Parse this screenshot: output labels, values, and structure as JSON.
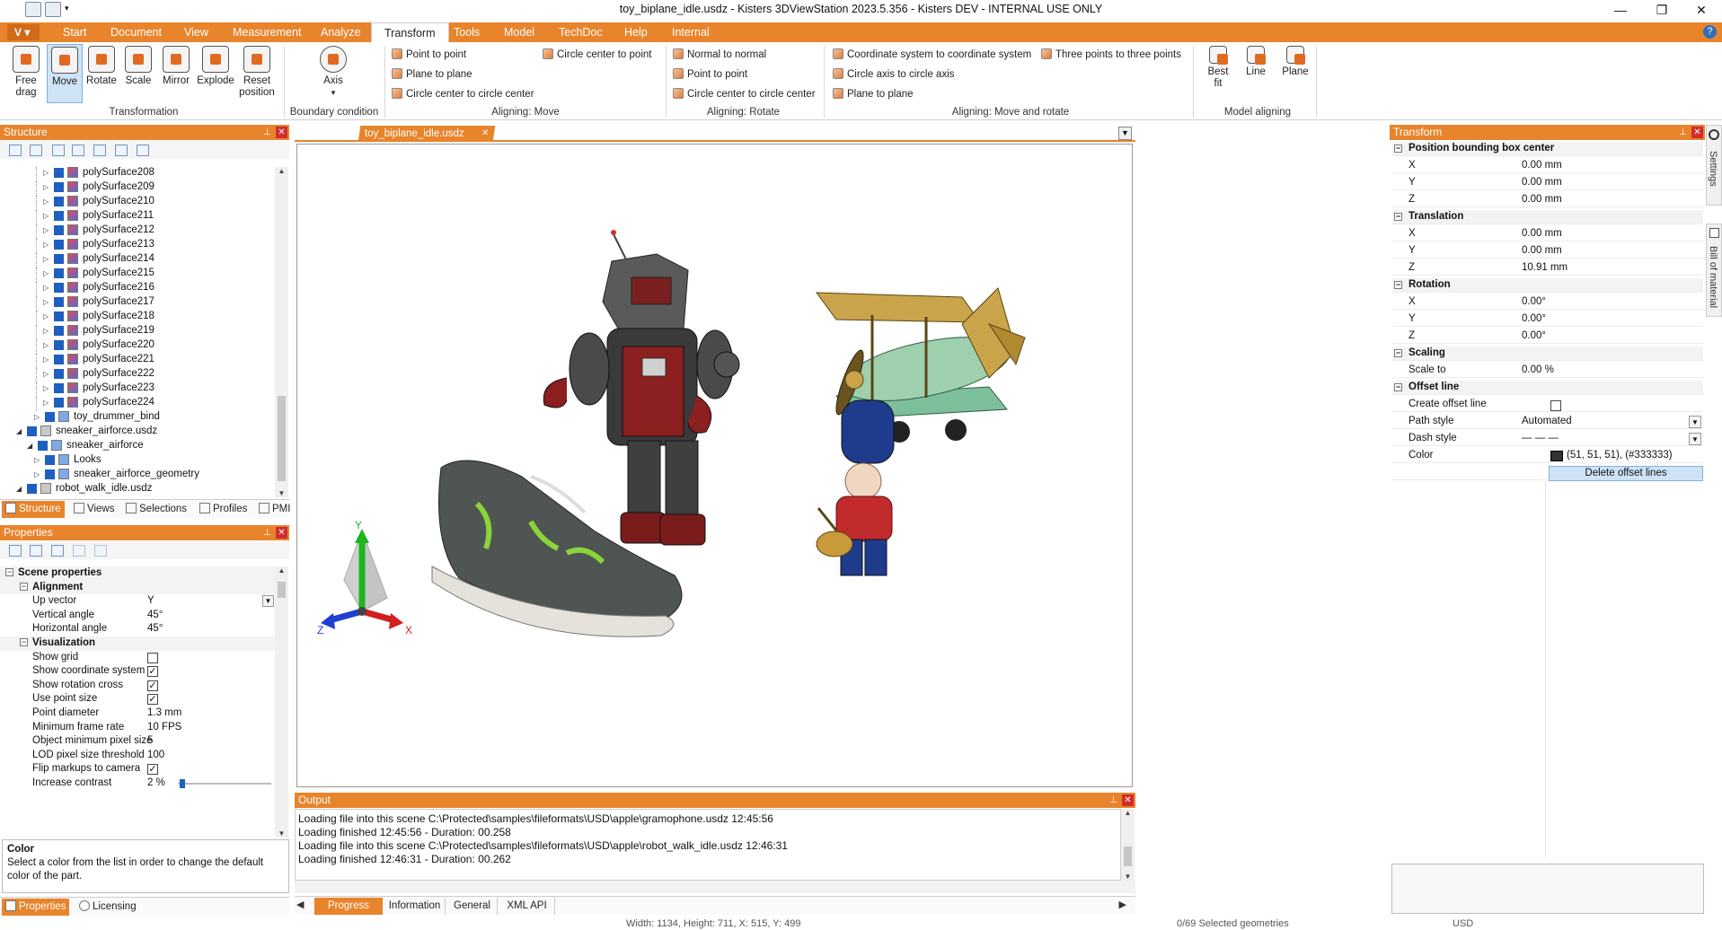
{
  "window": {
    "title": "toy_biplane_idle.usdz - Kisters 3DViewStation 2023.5.356 - Kisters DEV - INTERNAL USE ONLY",
    "minimize_icon": "minimize-icon",
    "restore_icon": "restore-icon",
    "close_icon": "close-icon"
  },
  "menu": {
    "app_button": "V",
    "items": [
      "Start",
      "Document",
      "View",
      "Measurement",
      "Analyze",
      "Transform",
      "Tools",
      "Model",
      "TechDoc",
      "Help",
      "Internal"
    ],
    "active": "Transform",
    "help": "?"
  },
  "ribbon": {
    "transformation": {
      "label": "Transformation",
      "buttons": [
        {
          "label": "Free\ndrag",
          "icon": "free-drag-icon"
        },
        {
          "label": "Move",
          "icon": "move-icon",
          "active": true
        },
        {
          "label": "Rotate",
          "icon": "rotate-icon"
        },
        {
          "label": "Scale",
          "icon": "scale-icon"
        },
        {
          "label": "Mirror",
          "icon": "mirror-icon"
        },
        {
          "label": "Explode",
          "icon": "explode-icon"
        },
        {
          "label": "Reset\nposition",
          "icon": "reset-position-icon"
        }
      ]
    },
    "boundary": {
      "label": "Boundary condition",
      "axis_label": "Axis"
    },
    "aligning_move": {
      "label": "Aligning: Move",
      "items": [
        "Point to point",
        "Plane to plane",
        "Circle center to circle center",
        "Circle center to point"
      ]
    },
    "aligning_rotate": {
      "label": "Aligning: Rotate",
      "items": [
        "Normal to normal",
        "Point to point",
        "Circle center to circle center"
      ]
    },
    "aligning_move_rotate": {
      "label": "Aligning: Move and rotate",
      "items": [
        "Coordinate system to coordinate system",
        "Circle axis to circle axis",
        "Plane to plane",
        "Three points to three points"
      ]
    },
    "model_aligning": {
      "label": "Model aligning",
      "buttons": [
        "Best\nfit",
        "Line",
        "Plane"
      ]
    }
  },
  "structure": {
    "title": "Structure",
    "rows": [
      {
        "label": "polySurface208",
        "depth": 3
      },
      {
        "label": "polySurface209",
        "depth": 3
      },
      {
        "label": "polySurface210",
        "depth": 3
      },
      {
        "label": "polySurface211",
        "depth": 3
      },
      {
        "label": "polySurface212",
        "depth": 3
      },
      {
        "label": "polySurface213",
        "depth": 3
      },
      {
        "label": "polySurface214",
        "depth": 3
      },
      {
        "label": "polySurface215",
        "depth": 3
      },
      {
        "label": "polySurface216",
        "depth": 3
      },
      {
        "label": "polySurface217",
        "depth": 3
      },
      {
        "label": "polySurface218",
        "depth": 3
      },
      {
        "label": "polySurface219",
        "depth": 3
      },
      {
        "label": "polySurface220",
        "depth": 3
      },
      {
        "label": "polySurface221",
        "depth": 3
      },
      {
        "label": "polySurface222",
        "depth": 3
      },
      {
        "label": "polySurface223",
        "depth": 3
      },
      {
        "label": "polySurface224",
        "depth": 3
      },
      {
        "label": "toy_drummer_bind",
        "depth": 2
      },
      {
        "label": "sneaker_airforce.usdz",
        "depth": 0
      },
      {
        "label": "sneaker_airforce",
        "depth": 1
      },
      {
        "label": "Looks",
        "depth": 2
      },
      {
        "label": "sneaker_airforce_geometry",
        "depth": 2
      },
      {
        "label": "robot_walk_idle.usdz",
        "depth": 0
      }
    ],
    "tabs": [
      "Structure",
      "Views",
      "Selections",
      "Profiles",
      "PMI"
    ]
  },
  "properties": {
    "title": "Properties",
    "rows": [
      {
        "type": "cat0",
        "name": "Scene properties"
      },
      {
        "type": "cat1",
        "name": "Alignment"
      },
      {
        "type": "val",
        "name": "Up vector",
        "value": "Y",
        "dropdown": true
      },
      {
        "type": "val",
        "name": "Vertical angle",
        "value": "45°"
      },
      {
        "type": "val",
        "name": "Horizontal angle",
        "value": "45°"
      },
      {
        "type": "cat1",
        "name": "Visualization"
      },
      {
        "type": "chk",
        "name": "Show grid",
        "checked": false
      },
      {
        "type": "chk",
        "name": "Show coordinate system",
        "checked": true
      },
      {
        "type": "chk",
        "name": "Show rotation cross",
        "checked": true
      },
      {
        "type": "chk",
        "name": "Use point size",
        "checked": true
      },
      {
        "type": "val",
        "name": "Point diameter",
        "value": "1.3 mm"
      },
      {
        "type": "val",
        "name": "Minimum frame rate",
        "value": "10 FPS"
      },
      {
        "type": "val",
        "name": "Object minimum pixel size",
        "value": "5"
      },
      {
        "type": "val",
        "name": "LOD pixel size threshold",
        "value": "100"
      },
      {
        "type": "chk",
        "name": "Flip markups to camera",
        "checked": true
      },
      {
        "type": "slider",
        "name": "Increase contrast",
        "value": "2 %",
        "fraction": 0.02
      }
    ],
    "help_title": "Color",
    "help_text": "Select a color from the list in order to change the default color of the part.",
    "tabs": [
      "Properties",
      "Licensing"
    ]
  },
  "document_tab": {
    "label": "toy_biplane_idle.usdz"
  },
  "viewport": {
    "objects": [
      "robot",
      "biplane",
      "sneaker",
      "drummer"
    ],
    "axes": {
      "x": "X",
      "y": "Y",
      "z": "Z"
    }
  },
  "transform": {
    "title": "Transform",
    "rows": [
      {
        "type": "cat",
        "name": "Position bounding box center"
      },
      {
        "type": "val",
        "name": "X",
        "value": "0.00 mm"
      },
      {
        "type": "val",
        "name": "Y",
        "value": "0.00 mm"
      },
      {
        "type": "val",
        "name": "Z",
        "value": "0.00 mm"
      },
      {
        "type": "cat",
        "name": "Translation"
      },
      {
        "type": "val",
        "name": "X",
        "value": "0.00 mm"
      },
      {
        "type": "val",
        "name": "Y",
        "value": "0.00 mm"
      },
      {
        "type": "val",
        "name": "Z",
        "value": "10.91 mm"
      },
      {
        "type": "cat",
        "name": "Rotation"
      },
      {
        "type": "val",
        "name": "X",
        "value": "0.00°"
      },
      {
        "type": "val",
        "name": "Y",
        "value": "0.00°"
      },
      {
        "type": "val",
        "name": "Z",
        "value": "0.00°"
      },
      {
        "type": "cat",
        "name": "Scaling"
      },
      {
        "type": "val",
        "name": "Scale to",
        "value": "0.00 %"
      },
      {
        "type": "cat",
        "name": "Offset line"
      },
      {
        "type": "chk",
        "name": "Create offset line",
        "checked": false
      },
      {
        "type": "val",
        "name": "Path style",
        "value": "Automated",
        "dropdown": true
      },
      {
        "type": "val",
        "name": "Dash style",
        "value": "— — —",
        "dropdown": true
      },
      {
        "type": "color",
        "name": "Color",
        "value": "(51, 51, 51), (#333333)",
        "swatch": "#333333"
      },
      {
        "type": "btn",
        "name": "",
        "value": "Delete offset lines"
      }
    ],
    "side_tabs": [
      "Settings",
      "Bill of material"
    ]
  },
  "output": {
    "title": "Output",
    "lines": [
      "Loading file into this scene C:\\Protected\\samples\\fileformats\\USD\\apple\\gramophone.usdz 12:45:56",
      "Loading finished 12:45:56 - Duration: 00.258",
      "Loading file into this scene C:\\Protected\\samples\\fileformats\\USD\\apple\\robot_walk_idle.usdz 12:46:31",
      "Loading finished 12:46:31 - Duration: 00.262"
    ],
    "tabs": [
      "Progress",
      "Information",
      "General",
      "XML API"
    ]
  },
  "status": {
    "dims": "Width: 1134, Height: 711, X: 515, Y: 499",
    "selected": "0/69 Selected geometries",
    "unit": "USD"
  },
  "colors": {
    "accent": "#e8842c",
    "selection": "#cfe3f7",
    "checkbox_blue": "#1e5fbf"
  }
}
